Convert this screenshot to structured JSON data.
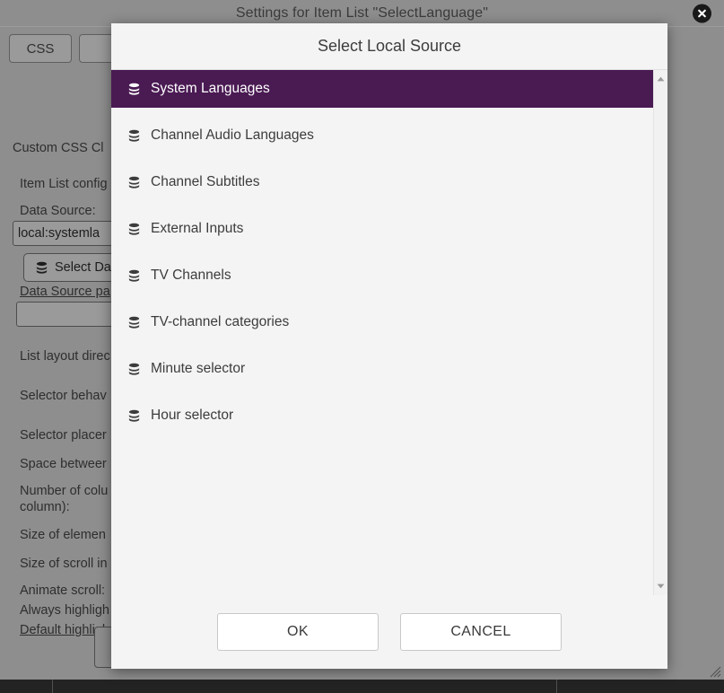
{
  "background_window": {
    "title": "Settings for Item List \"SelectLanguage\"",
    "close_icon": "close-circle-icon",
    "tabs": [
      {
        "label": "CSS"
      },
      {
        "label": ""
      }
    ],
    "fields": {
      "custom_css_class": "Custom CSS Cl",
      "item_list_config": "Item List config",
      "data_source_label": "Data Source:",
      "data_source_value": "local:systemla",
      "select_data_button": "Select Da",
      "select_data_icon": "database-icon",
      "data_source_param_label": "Data Source pa",
      "data_source_param_value": "",
      "list_layout_direction": "List layout direc",
      "selector_behaviour": "Selector behav",
      "selector_placement": "Selector placer",
      "space_between": "Space betweer",
      "number_of_columns": "Number of colu",
      "number_of_columns_line2": "column):",
      "size_of_element": "Size of elemen",
      "size_of_scroll": "Size of scroll in",
      "animate_scroll": "Animate scroll:",
      "always_highlight": "Always highligh",
      "default_highlight": "Default highligh"
    },
    "resize_grip_icon": "resize-grip-icon"
  },
  "dialog": {
    "title": "Select Local Source",
    "items": [
      {
        "label": "System Languages",
        "icon": "database-icon",
        "selected": true
      },
      {
        "label": "Channel Audio Languages",
        "icon": "database-icon",
        "selected": false
      },
      {
        "label": "Channel Subtitles",
        "icon": "database-icon",
        "selected": false
      },
      {
        "label": "External Inputs",
        "icon": "database-icon",
        "selected": false
      },
      {
        "label": "TV Channels",
        "icon": "database-icon",
        "selected": false
      },
      {
        "label": "TV-channel categories",
        "icon": "database-icon",
        "selected": false
      },
      {
        "label": "Minute selector",
        "icon": "database-icon",
        "selected": false
      },
      {
        "label": "Hour selector",
        "icon": "database-icon",
        "selected": false
      }
    ],
    "scrollbar": {
      "up_arrow_icon": "chevron-up-icon",
      "down_arrow_icon": "chevron-down-icon"
    },
    "buttons": {
      "ok": "OK",
      "cancel": "CANCEL"
    }
  },
  "colors": {
    "selection_purple": "#4a1a53",
    "window_gray": "#8e8e8e",
    "dialog_bg": "#f4f4f4"
  }
}
